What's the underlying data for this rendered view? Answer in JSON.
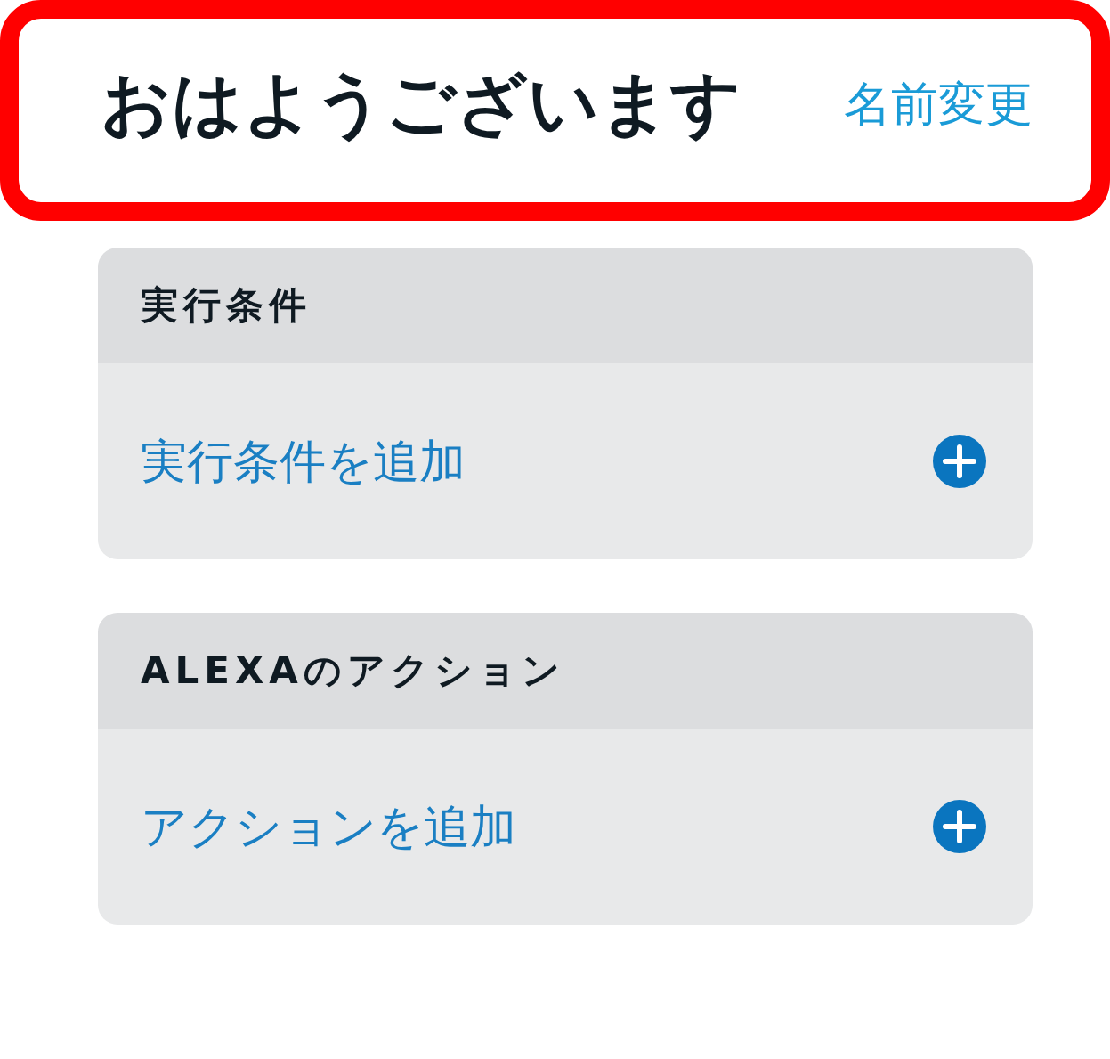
{
  "header": {
    "title": "おはようございます",
    "rename_link": "名前変更",
    "highlighted": true
  },
  "sections": [
    {
      "title": "実行条件",
      "add_label": "実行条件を追加"
    },
    {
      "title": "ALEXAのアクション",
      "add_label": "アクションを追加"
    }
  ]
}
